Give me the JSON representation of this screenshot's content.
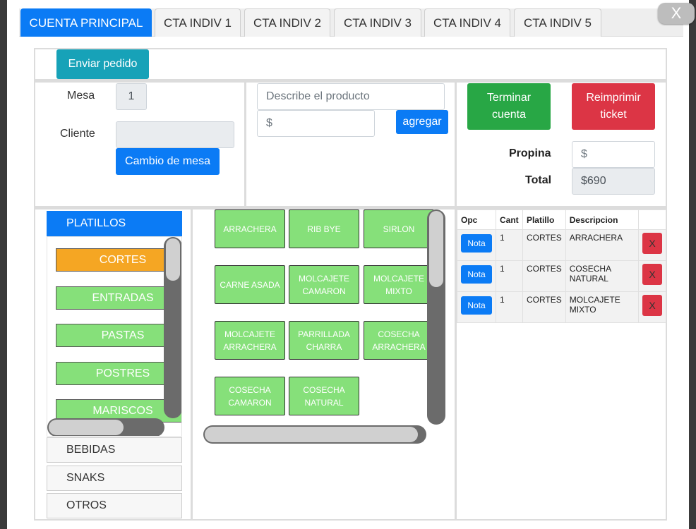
{
  "tabs": [
    {
      "label": "CUENTA PRINCIPAL",
      "active": true
    },
    {
      "label": "CTA INDIV 1"
    },
    {
      "label": "CTA INDIV 2"
    },
    {
      "label": "CTA INDIV 3"
    },
    {
      "label": "CTA INDIV 4"
    },
    {
      "label": "CTA INDIV 5"
    }
  ],
  "close_label": "X",
  "toolbar": {
    "send_order_label": "Enviar pedido"
  },
  "table_info": {
    "mesa_label": "Mesa",
    "mesa_value": "1",
    "cliente_label": "Cliente",
    "cliente_value": "",
    "change_table_label": "Cambio de mesa"
  },
  "custom_product": {
    "description_placeholder": "Describe el producto",
    "price_placeholder": "$",
    "add_label": "agregar"
  },
  "account": {
    "finish_label_1": "Terminar",
    "finish_label_2": "cuenta",
    "reprint_label_1": "Reimprimir",
    "reprint_label_2": "ticket",
    "tip_label": "Propina",
    "tip_placeholder": "$",
    "total_label": "Total",
    "total_value": "$690"
  },
  "categories": {
    "main": [
      "PLATILLOS",
      "BEBIDAS",
      "SNAKS",
      "OTROS"
    ],
    "subcategories": [
      "CORTES",
      "ENTRADAS",
      "PASTAS",
      "POSTRES",
      "MARISCOS"
    ]
  },
  "products": [
    [
      "ARRACHERA"
    ],
    [
      "RIB BYE"
    ],
    [
      "SIRLON"
    ],
    [
      "CARNE ASADA"
    ],
    [
      "MOLCAJETE",
      "CAMARON"
    ],
    [
      "MOLCAJETE",
      "MIXTO"
    ],
    [
      "MOLCAJETE",
      "ARRACHERA"
    ],
    [
      "PARRILLADA",
      "CHARRA"
    ],
    [
      "COSECHA",
      "ARRACHERA"
    ],
    [
      "COSECHA",
      "CAMARON"
    ],
    [
      "COSECHA",
      "NATURAL"
    ]
  ],
  "order_table": {
    "headers": [
      "Opc",
      "Cant",
      "Platillo",
      "Descripcion",
      ""
    ],
    "note_label": "Nota",
    "delete_label": "X",
    "rows": [
      {
        "cant": "1",
        "platillo": "CORTES",
        "desc_1": "ARRACHERA",
        "desc_2": ""
      },
      {
        "cant": "1",
        "platillo": "CORTES",
        "desc_1": "COSECHA",
        "desc_2": "NATURAL"
      },
      {
        "cant": "1",
        "platillo": "CORTES",
        "desc_1": "MOLCAJETE",
        "desc_2": "MIXTO"
      }
    ]
  },
  "colors": {
    "primary": "#0b7bf5",
    "teal": "#17a2b8",
    "success": "#28a745",
    "danger": "#dc3545",
    "category_green": "#86e07a",
    "category_active": "#f5a623"
  }
}
